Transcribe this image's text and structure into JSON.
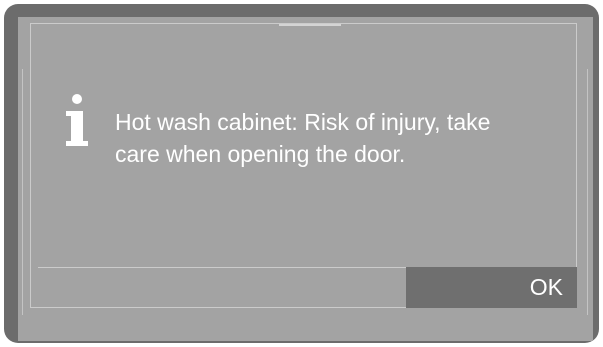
{
  "dialog": {
    "icon": "info-icon",
    "message_lines": [
      "Hot wash cabinet: Risk of injury, take",
      "care when opening the door."
    ],
    "ok_label": "OK"
  },
  "colors": {
    "bezel": "#6c6c6c",
    "screen": "#a3a3a3",
    "button": "#6f6f6f",
    "text": "#ffffff"
  }
}
